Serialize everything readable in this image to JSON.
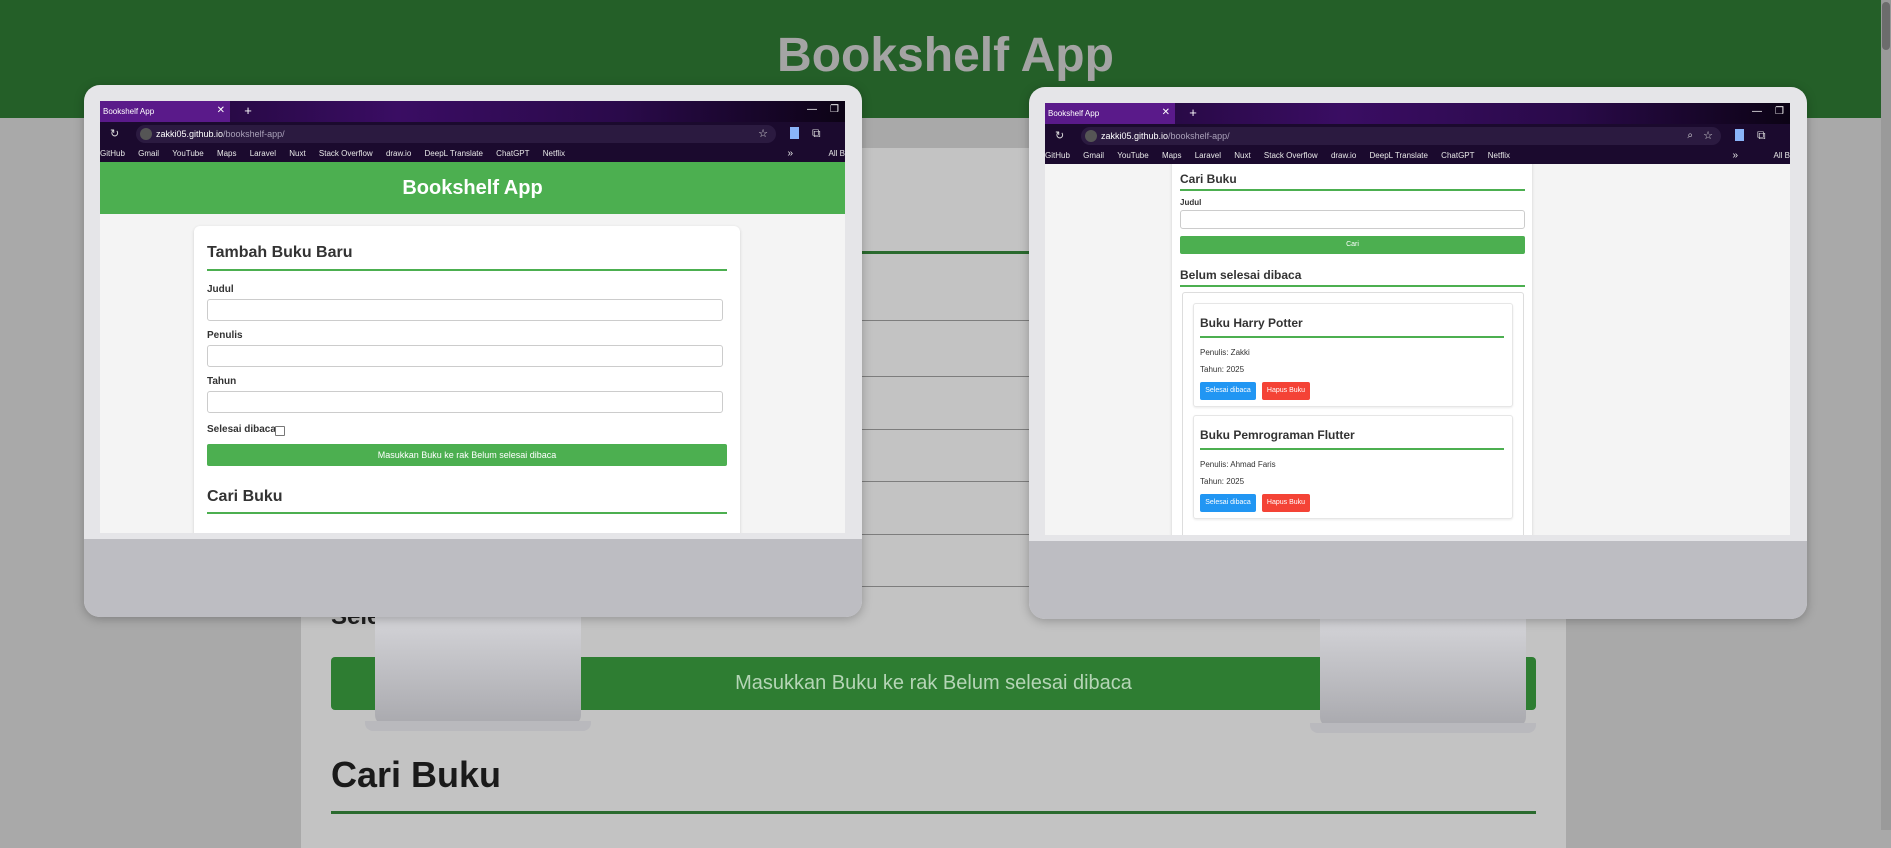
{
  "background_page": {
    "title": "Bookshelf App",
    "partial_label": "Sele",
    "submit_button": "Masukkan Buku ke rak Belum selesai dibaca",
    "search_heading": "Cari Buku"
  },
  "browser": {
    "tab_title": "Bookshelf App",
    "tab_close": "✕",
    "new_tab": "+",
    "url_host": "zakki05.github.io",
    "url_path": "/bookshelf-app/",
    "bookmarks": [
      "GitHub",
      "Gmail",
      "YouTube",
      "Maps",
      "Laravel",
      "Nuxt",
      "Stack Overflow",
      "draw.io",
      "DeepL Translate",
      "ChatGPT",
      "Netflix"
    ],
    "bookmarks_overflow": "»",
    "all_bookmarks": "All B"
  },
  "left_screen": {
    "app_title": "Bookshelf App",
    "form_heading": "Tambah Buku Baru",
    "title_label": "Judul",
    "author_label": "Penulis",
    "year_label": "Tahun",
    "complete_label": "Selesai dibaca",
    "submit_label": "Masukkan Buku ke rak Belum selesai dibaca",
    "search_heading": "Cari Buku"
  },
  "right_screen": {
    "search_heading": "Cari Buku",
    "search_label": "Judul",
    "search_button": "Cari",
    "shelf_heading": "Belum selesai dibaca",
    "books": [
      {
        "title": "Buku Harry Potter",
        "author": "Penulis: Zakki",
        "year": "Tahun: 2025",
        "done_button": "Selesai dibaca",
        "delete_button": "Hapus Buku"
      },
      {
        "title": "Buku Pemrograman Flutter",
        "author": "Penulis: Ahmad Faris",
        "year": "Tahun: 2025",
        "done_button": "Selesai dibaca",
        "delete_button": "Hapus Buku"
      }
    ]
  }
}
